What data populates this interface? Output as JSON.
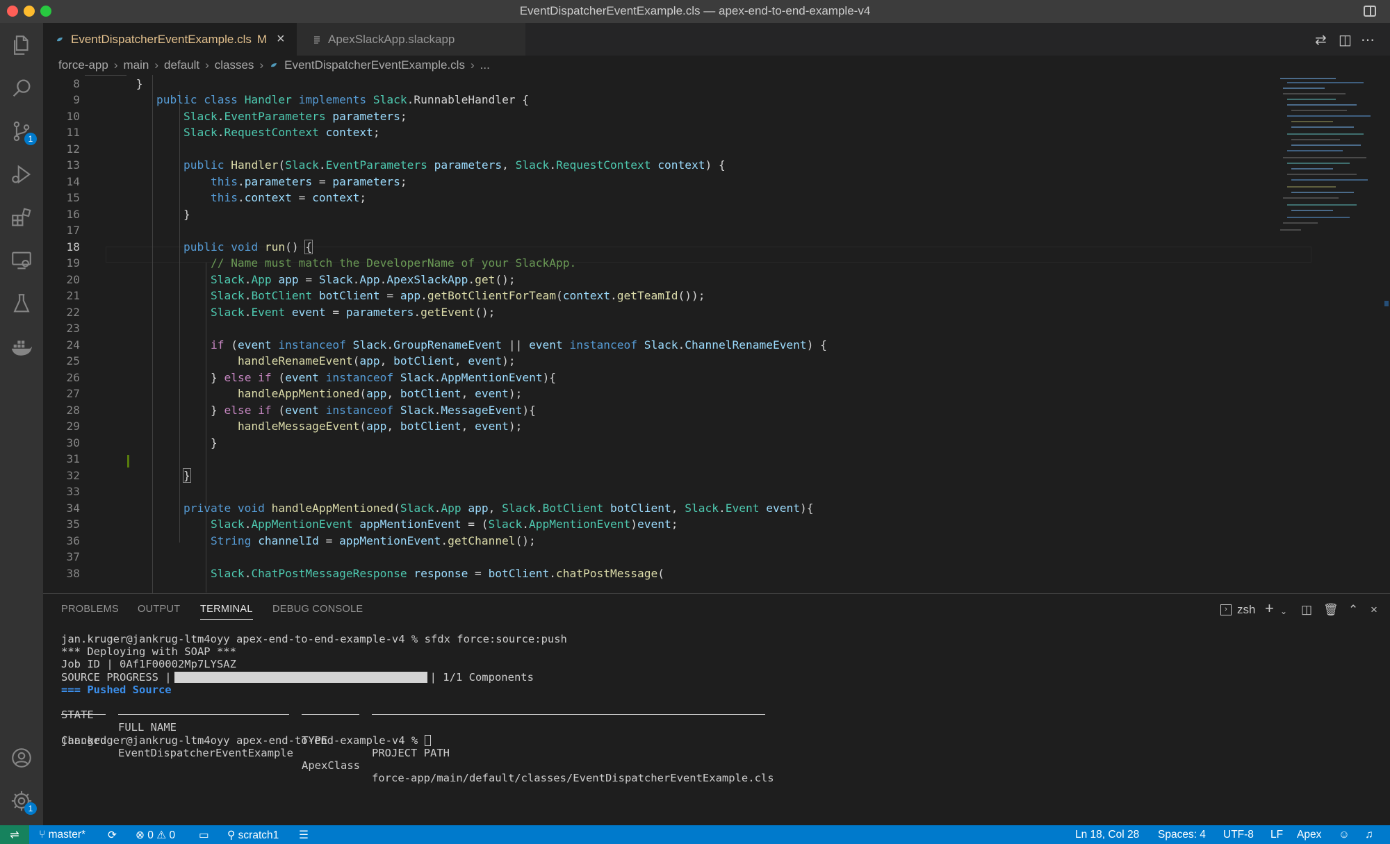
{
  "window": {
    "title": "EventDispatcherEventExample.cls — apex-end-to-end-example-v4"
  },
  "activity_bar": {
    "items": [
      {
        "name": "explorer",
        "icon": "files-icon"
      },
      {
        "name": "search",
        "icon": "search-icon"
      },
      {
        "name": "source-control",
        "icon": "source-control-icon",
        "badge": "1"
      },
      {
        "name": "run-debug",
        "icon": "run-debug-icon"
      },
      {
        "name": "extensions",
        "icon": "extensions-icon"
      },
      {
        "name": "remote-explorer",
        "icon": "remote-explorer-icon"
      },
      {
        "name": "testing",
        "icon": "beaker-icon"
      },
      {
        "name": "docker",
        "icon": "docker-icon"
      }
    ],
    "bottom": [
      {
        "name": "accounts",
        "icon": "account-icon"
      },
      {
        "name": "manage",
        "icon": "gear-icon",
        "badge": "1"
      }
    ]
  },
  "tabs": [
    {
      "label": "EventDispatcherEventExample.cls",
      "modified": "M",
      "active": true,
      "icon": "apex-file-icon"
    },
    {
      "label": "ApexSlackApp.slackapp",
      "active": false,
      "icon": "file-lines-icon"
    }
  ],
  "breadcrumb": [
    "force-app",
    "main",
    "default",
    "classes",
    "EventDispatcherEventExample.cls",
    "..."
  ],
  "editor": {
    "current_line": "18",
    "line_numbers": [
      "8",
      "9",
      "10",
      "11",
      "12",
      "13",
      "14",
      "15",
      "16",
      "17",
      "18",
      "19",
      "20",
      "21",
      "22",
      "23",
      "24",
      "25",
      "26",
      "27",
      "28",
      "29",
      "30",
      "31",
      "32",
      "33",
      "34",
      "35",
      "36",
      "37",
      "38"
    ]
  },
  "panel": {
    "tabs": [
      "PROBLEMS",
      "OUTPUT",
      "TERMINAL",
      "DEBUG CONSOLE"
    ],
    "active_tab": "TERMINAL",
    "shell": "zsh",
    "terminal": {
      "prompt": "jan.kruger@jankrug-ltm4oyy apex-end-to-end-example-v4 % ",
      "command": "sfdx force:source:push",
      "deploy_line": "*** Deploying with SOAP ***",
      "job_line": "Job ID | 0Af1F00002Mp7LYSAZ",
      "progress_label": "SOURCE PROGRESS |",
      "progress_fraction": 1.0,
      "progress_suffix": "| 1/1 Components",
      "pushed_prefix": "=== ",
      "pushed_title": "Pushed Source",
      "headers": [
        "STATE",
        "FULL NAME",
        "TYPE",
        "PROJECT PATH"
      ],
      "row": [
        "Changed",
        "EventDispatcherEventExample",
        "ApexClass",
        "force-app/main/default/classes/EventDispatcherEventExample.cls"
      ],
      "final_prompt": "jan.kruger@jankrug-ltm4oyy apex-end-to-end-example-v4 % "
    }
  },
  "status_bar": {
    "branch": "master*",
    "errors": "0",
    "warnings": "0",
    "org": "scratch1",
    "cursor": "Ln 18, Col 28",
    "spaces": "Spaces: 4",
    "encoding": "UTF-8",
    "eol": "LF",
    "language": "Apex"
  },
  "colors": {
    "accent": "#007acc",
    "remote": "#16825d",
    "modified": "#e2c08d"
  }
}
